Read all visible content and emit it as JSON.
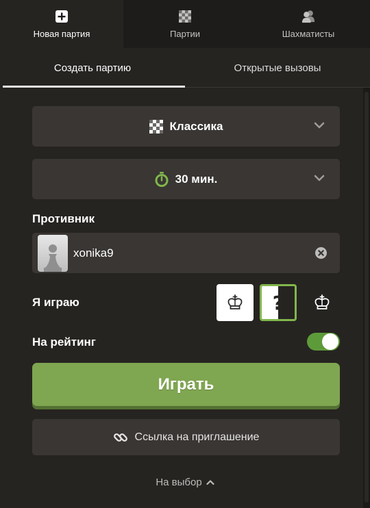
{
  "top_tabs": [
    {
      "label": "Новая партия",
      "icon": "plus-square-icon",
      "active": true
    },
    {
      "label": "Партии",
      "icon": "chessboard-icon",
      "active": false
    },
    {
      "label": "Шахматисты",
      "icon": "players-icon",
      "active": false
    }
  ],
  "sub_tabs": [
    {
      "label": "Создать партию",
      "active": true
    },
    {
      "label": "Открытые вызовы",
      "active": false
    }
  ],
  "game_type": {
    "label": "Классика",
    "icon": "chessboard-icon"
  },
  "time_control": {
    "label": "30 мин.",
    "icon": "stopwatch-icon",
    "icon_color": "#81b64c"
  },
  "opponent": {
    "section_label": "Противник",
    "name": "xonika9"
  },
  "color_choice": {
    "label": "Я играю",
    "options": [
      "white",
      "random",
      "black"
    ],
    "selected": "random",
    "random_symbol": "?"
  },
  "rated": {
    "label": "На рейтинг",
    "enabled": true
  },
  "play_button": {
    "label": "Играть",
    "color": "#7fa650"
  },
  "invite_button": {
    "label": "Ссылка на приглашение"
  },
  "more_options": {
    "label": "На выбор"
  }
}
